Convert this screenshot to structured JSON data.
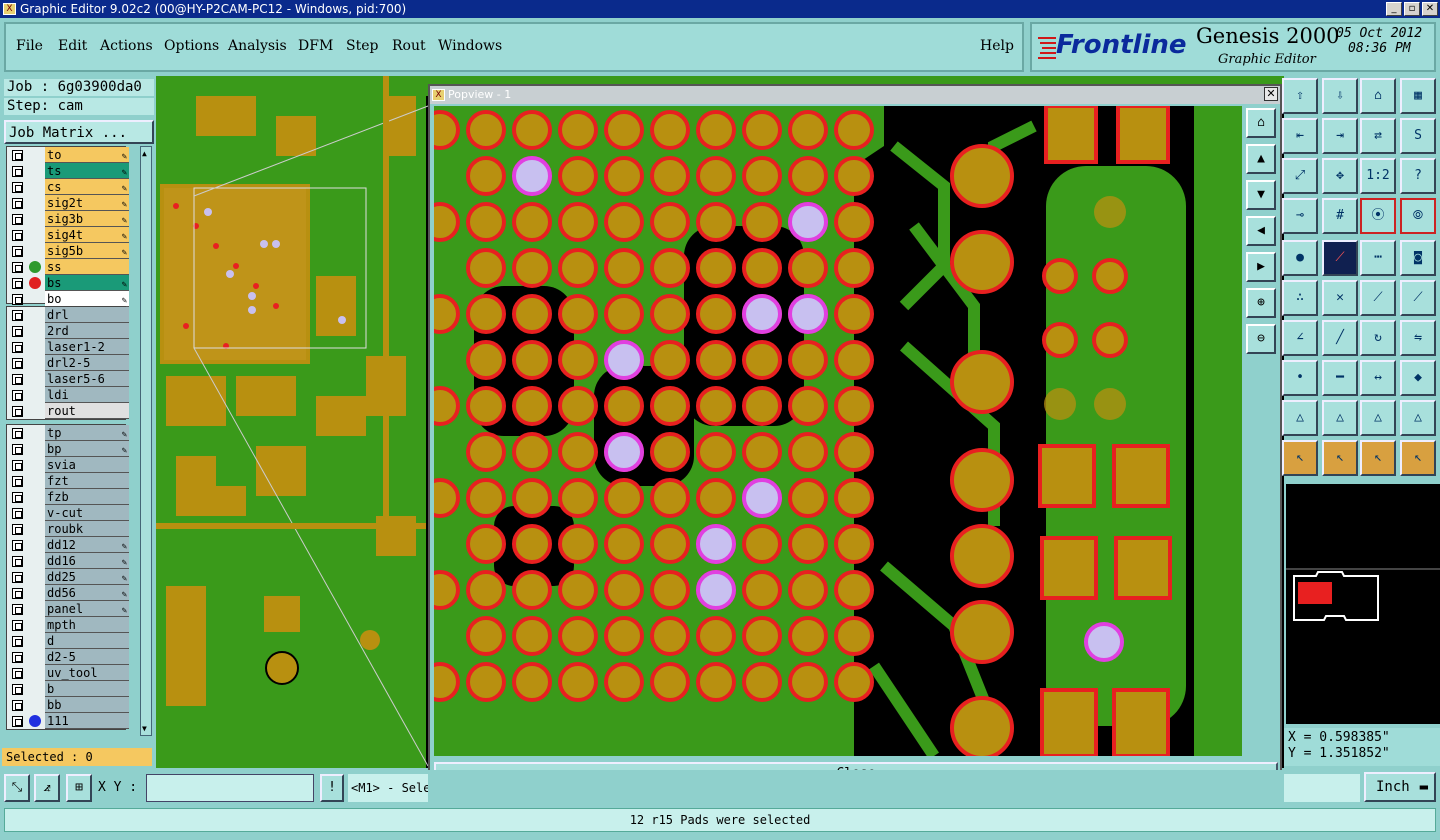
{
  "window": {
    "title": "Graphic Editor 9.02c2 (00@HY-P2CAM-PC12 - Windows, pid:700)",
    "icon": "app-x-icon"
  },
  "menu": {
    "items": [
      "File",
      "Edit",
      "Actions",
      "Options",
      "Analysis",
      "DFM",
      "Step",
      "Rout",
      "Windows"
    ],
    "help": "Help"
  },
  "brand": {
    "logo": "Frontline",
    "product": "Genesis 2000",
    "subtitle": "Graphic Editor",
    "date": "05 Oct 2012",
    "time": "08:36 PM"
  },
  "job": {
    "job_label": "Job : 6g03900da0",
    "step_label": "Step: cam",
    "matrix_button": "Job Matrix ..."
  },
  "layers_group1": [
    {
      "name": "to",
      "color": "#f5c860",
      "dot": "",
      "pen": true
    },
    {
      "name": "ts",
      "color": "#1a9a78",
      "dot": "",
      "pen": true
    },
    {
      "name": "cs",
      "color": "#f5c860",
      "dot": "",
      "pen": true
    },
    {
      "name": "sig2t",
      "color": "#f5c860",
      "dot": "",
      "pen": true
    },
    {
      "name": "sig3b",
      "color": "#f5c860",
      "dot": "",
      "pen": true
    },
    {
      "name": "sig4t",
      "color": "#f5c860",
      "dot": "",
      "pen": true
    },
    {
      "name": "sig5b",
      "color": "#f5c860",
      "dot": "",
      "pen": true
    },
    {
      "name": "ss",
      "color": "#f5c860",
      "dot": "#2e9a2e",
      "pen": false
    },
    {
      "name": "bs",
      "color": "#1a9a78",
      "dot": "#e02020",
      "pen": true
    },
    {
      "name": "bo",
      "color": "#ffffff",
      "dot": "",
      "pen": true
    }
  ],
  "layers_group2": [
    {
      "name": "drl",
      "color": "#a0b8c0",
      "pen": false
    },
    {
      "name": "2rd",
      "color": "#a0b8c0",
      "pen": false
    },
    {
      "name": "laser1-2",
      "color": "#a0b8c0",
      "pen": false
    },
    {
      "name": "drl2-5",
      "color": "#a0b8c0",
      "pen": false
    },
    {
      "name": "laser5-6",
      "color": "#a0b8c0",
      "pen": false
    },
    {
      "name": "ldi",
      "color": "#a0b8c0",
      "pen": false
    },
    {
      "name": "rout",
      "color": "#e0e0e0",
      "pen": false
    }
  ],
  "layers_group3": [
    {
      "name": "tp",
      "pen": true
    },
    {
      "name": "bp",
      "pen": true
    },
    {
      "name": "svia",
      "pen": false
    },
    {
      "name": "fzt",
      "pen": false
    },
    {
      "name": "fzb",
      "pen": false
    },
    {
      "name": "v-cut",
      "pen": false
    },
    {
      "name": "roubk",
      "pen": false
    },
    {
      "name": "dd12",
      "pen": true
    },
    {
      "name": "dd16",
      "pen": true
    },
    {
      "name": "dd25",
      "pen": true
    },
    {
      "name": "dd56",
      "pen": true
    },
    {
      "name": "panel",
      "pen": true
    },
    {
      "name": "mpth",
      "pen": false
    },
    {
      "name": "d",
      "pen": false
    },
    {
      "name": "d2-5",
      "pen": false
    },
    {
      "name": "uv_tool",
      "pen": false
    },
    {
      "name": "b",
      "pen": false
    },
    {
      "name": "bb",
      "pen": false
    },
    {
      "name": "111",
      "pen": false,
      "dot": "#2030e0"
    }
  ],
  "selected": "Selected : 0",
  "popup": {
    "title": "Popview - 1",
    "close_label": "Close"
  },
  "xy": {
    "label": "X Y :",
    "value": ""
  },
  "prompt": "<M1> - Sele",
  "coords": {
    "x": "X = 0.598385\"",
    "y": "Y = 1.351852\""
  },
  "units": "Inch",
  "status": "12 r15 Pads were selected",
  "colors": {
    "pcb_green": "#3a9a1a",
    "pad_gold": "#b89010",
    "pad_red_ring": "#e82020",
    "via_lilac": "#c8c0f0",
    "via_magenta_ring": "#e040e0",
    "background_black": "#000000"
  }
}
